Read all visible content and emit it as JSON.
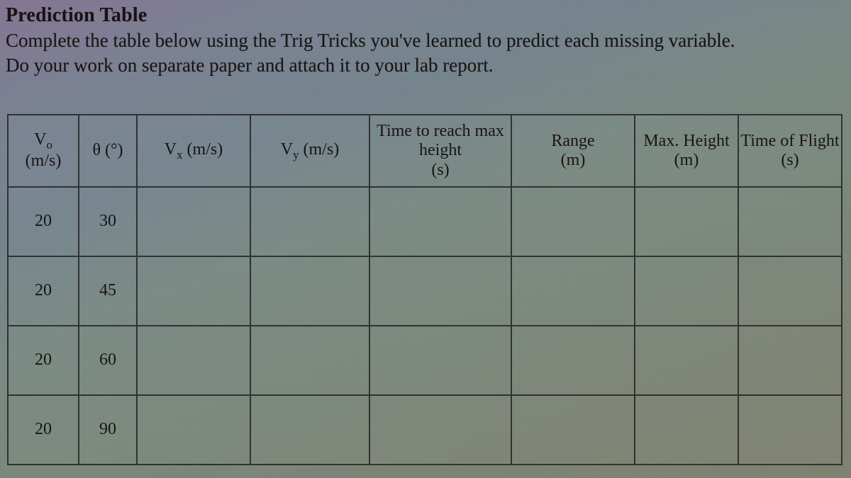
{
  "title": "Prediction Table",
  "instructions": {
    "line1": "Complete the table below using the Trig Tricks you've learned to predict each missing variable.",
    "line2": "Do your work on separate paper and attach it to your lab report."
  },
  "headers": {
    "vo": {
      "label": "Vo",
      "unit": "(m/s)"
    },
    "theta": {
      "label": "θ (°)"
    },
    "vx": {
      "label": "Vx (m/s)"
    },
    "vy": {
      "label": "Vy (m/s)"
    },
    "t_max": {
      "label": "Time to reach max height",
      "unit": "(s)"
    },
    "range": {
      "label": "Range",
      "unit": "(m)"
    },
    "h_max": {
      "label": "Max. Height",
      "unit": "(m)"
    },
    "tof": {
      "label": "Time of Flight",
      "unit": "(s)"
    }
  },
  "rows": [
    {
      "vo": "20",
      "theta": "30",
      "vx": "",
      "vy": "",
      "t_max": "",
      "range": "",
      "h_max": "",
      "tof": ""
    },
    {
      "vo": "20",
      "theta": "45",
      "vx": "",
      "vy": "",
      "t_max": "",
      "range": "",
      "h_max": "",
      "tof": ""
    },
    {
      "vo": "20",
      "theta": "60",
      "vx": "",
      "vy": "",
      "t_max": "",
      "range": "",
      "h_max": "",
      "tof": ""
    },
    {
      "vo": "20",
      "theta": "90",
      "vx": "",
      "vy": "",
      "t_max": "",
      "range": "",
      "h_max": "",
      "tof": ""
    }
  ],
  "chart_data": {
    "type": "table",
    "columns": [
      "Vo (m/s)",
      "θ (°)",
      "Vx (m/s)",
      "Vy (m/s)",
      "Time to reach max height (s)",
      "Range (m)",
      "Max. Height (m)",
      "Time of Flight (s)"
    ],
    "data": [
      [
        20,
        30,
        null,
        null,
        null,
        null,
        null,
        null
      ],
      [
        20,
        45,
        null,
        null,
        null,
        null,
        null,
        null
      ],
      [
        20,
        60,
        null,
        null,
        null,
        null,
        null,
        null
      ],
      [
        20,
        90,
        null,
        null,
        null,
        null,
        null,
        null
      ]
    ]
  }
}
